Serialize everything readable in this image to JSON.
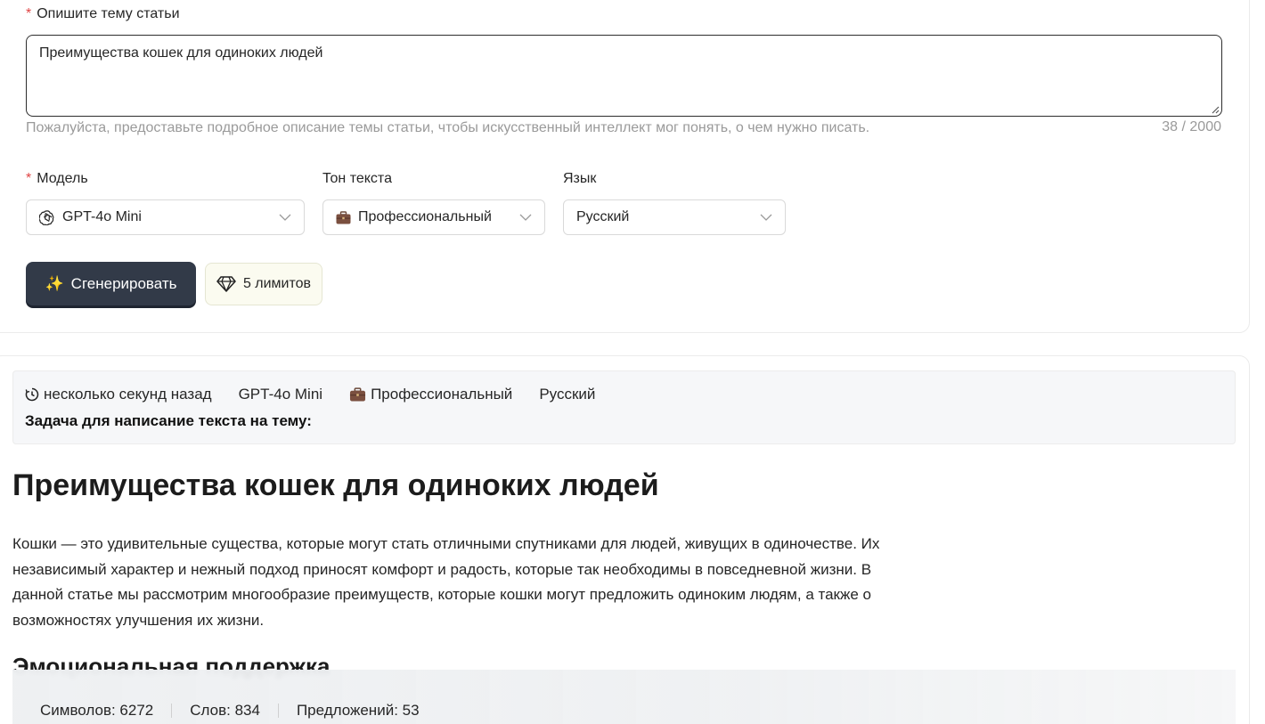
{
  "form": {
    "topic_label": "Опишите тему статьи",
    "topic_value": "Преимущества кошек для одиноких людей",
    "topic_hint": "Пожалуйста, предоставьте подробное описание темы статьи, чтобы искусственный интеллект мог понять, о чем нужно писать.",
    "topic_counter": "38 / 2000",
    "required_mark": "*",
    "model_label": "Модель",
    "model_value": "GPT-4o Mini",
    "tone_label": "Тон текста",
    "tone_value": "Профессиональный",
    "lang_label": "Язык",
    "lang_value": "Русский",
    "generate_label": "Сгенерировать",
    "generate_emoji": "✨",
    "limits_label": "5 лимитов"
  },
  "result": {
    "meta": {
      "time": "несколько секунд назад",
      "model": "GPT-4o Mini",
      "tone": "Профессиональный",
      "lang": "Русский",
      "task": "Задача для написание текста на тему:"
    },
    "title": "Преимущества кошек для одиноких людей",
    "intro": "Кошки — это удивительные существа, которые могут стать отличными спутниками для людей, живущих в одиночестве. Их независимый характер и нежный подход приносят комфорт и радость, которые так необходимы в повседневной жизни. В данной статье мы рассмотрим многообразие преимуществ, которые кошки могут предложить одиноким людям, а также о возможностях улучшения их жизни.",
    "section1": "Эмоциональная поддержка"
  },
  "stats": {
    "chars": "Символов: 6272",
    "words": "Слов: 834",
    "sentences": "Предложений: 53"
  },
  "icons": {
    "model": "openai-logo-icon",
    "tone": "briefcase-icon",
    "time": "clock-icon",
    "limits": "diamond-icon",
    "dropdown": "chevron-down-icon"
  }
}
